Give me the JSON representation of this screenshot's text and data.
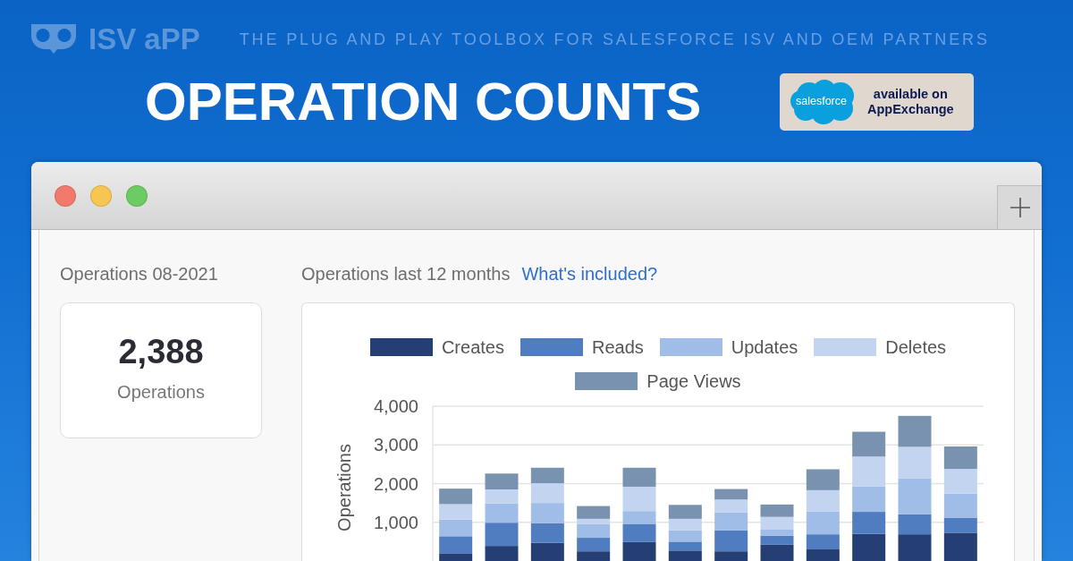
{
  "header": {
    "logo_text": "ISV aPP",
    "tagline": "THE PLUG AND PLAY TOOLBOX FOR SALESFORCE ISV AND OEM PARTNERS",
    "title": "OPERATION COUNTS",
    "badge": {
      "logo_text": "salesforce",
      "lines": [
        "available on",
        "AppExchange"
      ]
    }
  },
  "summary": {
    "heading": "Operations 08-2021",
    "value": "2,388",
    "caption": "Operations"
  },
  "chart_panel": {
    "heading": "Operations last 12 months",
    "link": "What's included?",
    "chart_data": {
      "type": "bar",
      "stacked": true,
      "grid": true,
      "legend": true,
      "ylabel": "Operations",
      "ylim": [
        0,
        4000
      ],
      "yticks": [
        {
          "value": 1000,
          "label": "1,000"
        },
        {
          "value": 2000,
          "label": "2,000"
        },
        {
          "value": 3000,
          "label": "3,000"
        },
        {
          "value": 4000,
          "label": "4,000"
        }
      ],
      "series": [
        {
          "name": "Creates",
          "color": "#253f74",
          "values": [
            200,
            390,
            470,
            250,
            490,
            270,
            250,
            420,
            300,
            700,
            690,
            730
          ]
        },
        {
          "name": "Reads",
          "color": "#4f7dc0",
          "values": [
            440,
            600,
            510,
            350,
            470,
            230,
            540,
            230,
            390,
            570,
            520,
            390
          ]
        },
        {
          "name": "Updates",
          "color": "#9fbde7",
          "values": [
            430,
            500,
            520,
            350,
            330,
            290,
            470,
            160,
            590,
            660,
            920,
            620
          ]
        },
        {
          "name": "Deletes",
          "color": "#c2d4f0",
          "values": [
            400,
            360,
            510,
            140,
            630,
            300,
            330,
            330,
            550,
            770,
            820,
            640
          ]
        },
        {
          "name": "Page Views",
          "color": "#7892b0",
          "values": [
            400,
            410,
            400,
            330,
            490,
            360,
            270,
            320,
            540,
            640,
            800,
            580
          ]
        }
      ]
    }
  }
}
